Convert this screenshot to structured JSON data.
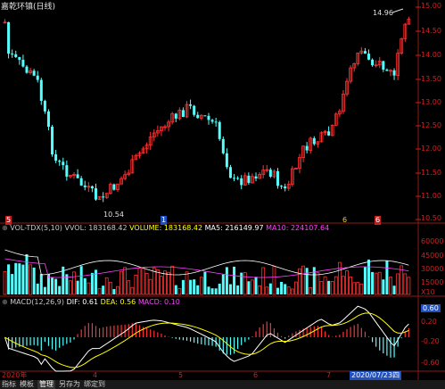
{
  "window": {
    "title": "嘉乾环镇(日线)"
  },
  "price_panel": {
    "axis_ticks": [
      "15.00",
      "14.50",
      "14.00",
      "13.50",
      "13.00",
      "12.50",
      "12.00",
      "11.50",
      "11.00",
      "10.50"
    ],
    "high_label": "14.96",
    "low_label": "10.54",
    "flags": [
      "5",
      "1",
      "6",
      "6"
    ]
  },
  "volume_panel": {
    "indicator": "VOL-TDX(5,10)",
    "vvol": "VVOL: 183168.42",
    "volume": "VOLUME: 183168.42",
    "ma5": "MA5: 216149.97",
    "ma10": "MA10: 224107.64",
    "axis_ticks": [
      "60000",
      "45000",
      "30000",
      "15000",
      "X10"
    ],
    "colors": {
      "vvol": "#c8c8c8",
      "volume": "#ffff00",
      "ma5": "#ffffff",
      "ma10": "#ff40ff"
    }
  },
  "macd_panel": {
    "indicator": "MACD(12,26,9)",
    "dif": "DIF: 0.61",
    "dea": "DEA: 0.56",
    "macd": "MACD: 0.10",
    "axis_ticks": [
      "0.60",
      "0.20",
      "-0.20",
      "-0.60"
    ],
    "colors": {
      "dif": "#ffffff",
      "dea": "#ffff00",
      "macd": "#ff40ff"
    }
  },
  "date_axis": {
    "labels": [
      "2020年",
      "4",
      "5",
      "6",
      "7"
    ],
    "cursor_date": "2020/07/23四"
  },
  "bottom_tabs": [
    "指标",
    "模板",
    "管理",
    "另存为",
    "绑定到"
  ],
  "active_tab": "管理",
  "colors": {
    "up": "#ff3232",
    "down": "#54ffff",
    "axis": "#d02020",
    "grid": "#8b1a1a"
  }
}
